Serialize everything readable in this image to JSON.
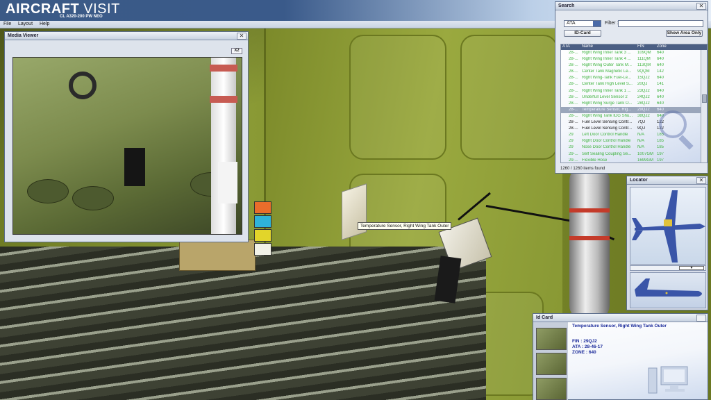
{
  "app": {
    "title_bold": "AIRCRAFT",
    "title_light": " VISIT",
    "subtitle": "CL A320-200 PW NEO"
  },
  "menu": [
    "File",
    "Layout",
    "Help"
  ],
  "media_viewer": {
    "title": "Media Viewer",
    "close": "✕",
    "zoom_button": "X2"
  },
  "search": {
    "title": "Search",
    "close": "✕",
    "category_value": "ATA",
    "filter_label": "Filter :",
    "filter_value": "",
    "id_card_button": "ID-Card",
    "show_area_button": "Show Area Only",
    "columns": [
      "ATA",
      "Name",
      "FIN",
      "Zone"
    ],
    "rows": [
      {
        "ata": "28-...",
        "name": "Right Wing Inner Tank 3 ...",
        "fin": "109QM",
        "zone": "640",
        "style": "green"
      },
      {
        "ata": "28-...",
        "name": "Right Wing Inner Tank 4 ...",
        "fin": "111QM",
        "zone": "640",
        "style": "green"
      },
      {
        "ata": "28-...",
        "name": "Right Wing Outer Tank M...",
        "fin": "113QM",
        "zone": "640",
        "style": "green"
      },
      {
        "ata": "28-...",
        "name": "Center Tank Magnetic Le...",
        "fin": "9QQM",
        "zone": "142",
        "style": "green"
      },
      {
        "ata": "28-...",
        "name": "Right Wing-Tank Fuel-Le...",
        "fin": "15QJ2",
        "zone": "640",
        "style": "green"
      },
      {
        "ata": "28-...",
        "name": "Center Tank High Level S...",
        "fin": "20QJ",
        "zone": "141",
        "style": "green"
      },
      {
        "ata": "28-...",
        "name": "Right Wing Inner Tank 1 ...",
        "fin": "23QJ2",
        "zone": "640",
        "style": "green"
      },
      {
        "ata": "28-...",
        "name": "Underfull Level Sensor 2",
        "fin": "24QJ2",
        "zone": "640",
        "style": "green"
      },
      {
        "ata": "28-...",
        "name": "Right Wing Surge Tank O...",
        "fin": "28QJ2",
        "zone": "640",
        "style": "green"
      },
      {
        "ata": "28-...",
        "name": "Temperature Sensor, Rig...",
        "fin": "29QJ2",
        "zone": "640",
        "style": "selected"
      },
      {
        "ata": "28-...",
        "name": "Right Wing Tank IDG Shu...",
        "fin": "38QJ2",
        "zone": "640",
        "style": "green"
      },
      {
        "ata": "28-...",
        "name": "Fuel Level Sensing Contr...",
        "fin": "7QJ",
        "zone": "122",
        "style": "black"
      },
      {
        "ata": "28-...",
        "name": "Fuel Level Sensing Contr...",
        "fin": "9QJ",
        "zone": "122",
        "style": "black"
      },
      {
        "ata": "29",
        "name": "Left Door Control Handle",
        "fin": "N/A",
        "zone": "185",
        "style": "green"
      },
      {
        "ata": "29",
        "name": "Right Door Control Handle",
        "fin": "N/A",
        "zone": "185",
        "style": "green"
      },
      {
        "ata": "29",
        "name": "Nose Door Control Handle",
        "fin": "N/A",
        "zone": "185",
        "style": "green"
      },
      {
        "ata": "29-...",
        "name": "Self Sealing Coupling Se...",
        "fin": "1007GM",
        "zone": "197",
        "style": "green"
      },
      {
        "ata": "29-...",
        "name": "Flexible Hose",
        "fin": "1699GM",
        "zone": "197",
        "style": "green"
      }
    ],
    "count": "1260 / 1260 items found"
  },
  "tooltip": "Temperature Sensor, Right Wing Tank Outer",
  "locator": {
    "title": "Locator",
    "close": "✕"
  },
  "id_card": {
    "title": "Id Card",
    "name": "Temperature Sensor, Right Wing Tank Outer",
    "fin": "FIN : 29QJ2",
    "ata": "ATA : 28-46-17",
    "zone": "ZONE : 640"
  },
  "colors": {
    "title_blue": "#3b5a86",
    "list_green": "#3fb33f",
    "id_text": "#1a2a9a"
  }
}
